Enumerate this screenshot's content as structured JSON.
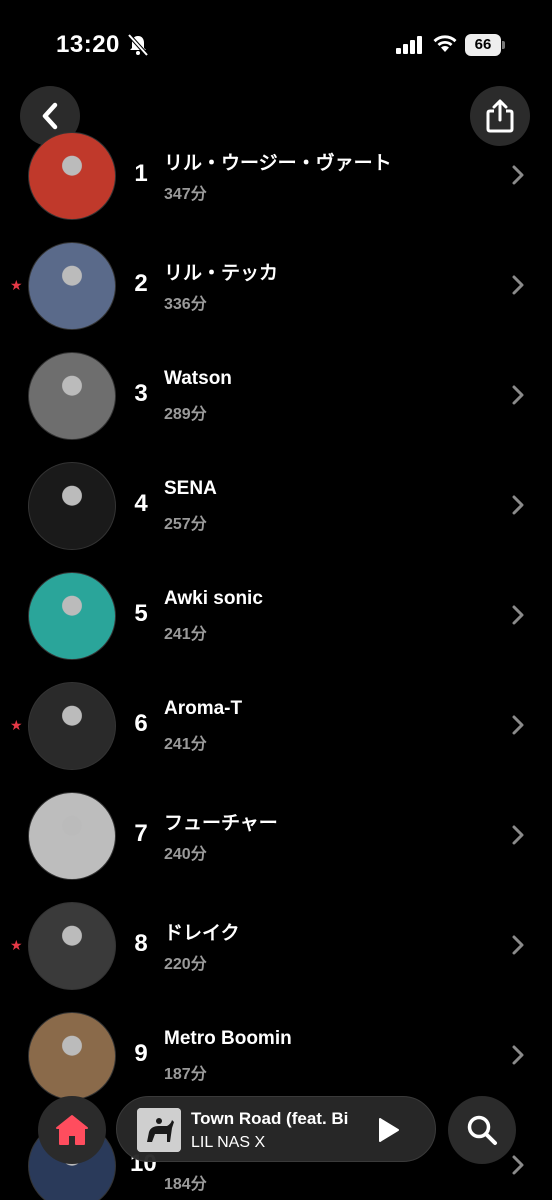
{
  "status_bar": {
    "time": "13:20",
    "battery": "66"
  },
  "header": {
    "back_icon": "chevron-left-icon",
    "share_icon": "share-icon"
  },
  "artists": [
    {
      "rank": "1",
      "name": "リル・ウージー・ヴァート",
      "minutes": "347分",
      "starred": false,
      "avatar_color": "#c0392b"
    },
    {
      "rank": "2",
      "name": "リル・テッカ",
      "minutes": "336分",
      "starred": true,
      "avatar_color": "#5a6a8a"
    },
    {
      "rank": "3",
      "name": "Watson",
      "minutes": "289分",
      "starred": false,
      "avatar_color": "#6e6e6e"
    },
    {
      "rank": "4",
      "name": "SENA",
      "minutes": "257分",
      "starred": false,
      "avatar_color": "#1a1a1a"
    },
    {
      "rank": "5",
      "name": "Awki sonic",
      "minutes": "241分",
      "starred": false,
      "avatar_color": "#2aa59a"
    },
    {
      "rank": "6",
      "name": "Aroma-T",
      "minutes": "241分",
      "starred": true,
      "avatar_color": "#2a2a2a"
    },
    {
      "rank": "7",
      "name": "フューチャー",
      "minutes": "240分",
      "starred": false,
      "avatar_color": "#bdbdbd"
    },
    {
      "rank": "8",
      "name": "ドレイク",
      "minutes": "220分",
      "starred": true,
      "avatar_color": "#3a3a3a"
    },
    {
      "rank": "9",
      "name": "Metro Boomin",
      "minutes": "187分",
      "starred": false,
      "avatar_color": "#8a6a4a"
    },
    {
      "rank": "10",
      "name": "",
      "minutes": "184分",
      "starred": false,
      "avatar_color": "#2a3a5a"
    }
  ],
  "now_playing": {
    "title": "Town Road (feat. Bi",
    "artist": "LIL NAS X"
  },
  "nav": {
    "home_icon": "home-icon",
    "search_icon": "search-icon"
  },
  "colors": {
    "accent_red": "#e63946",
    "background": "#000000",
    "button_bg": "#2b2b2b"
  }
}
